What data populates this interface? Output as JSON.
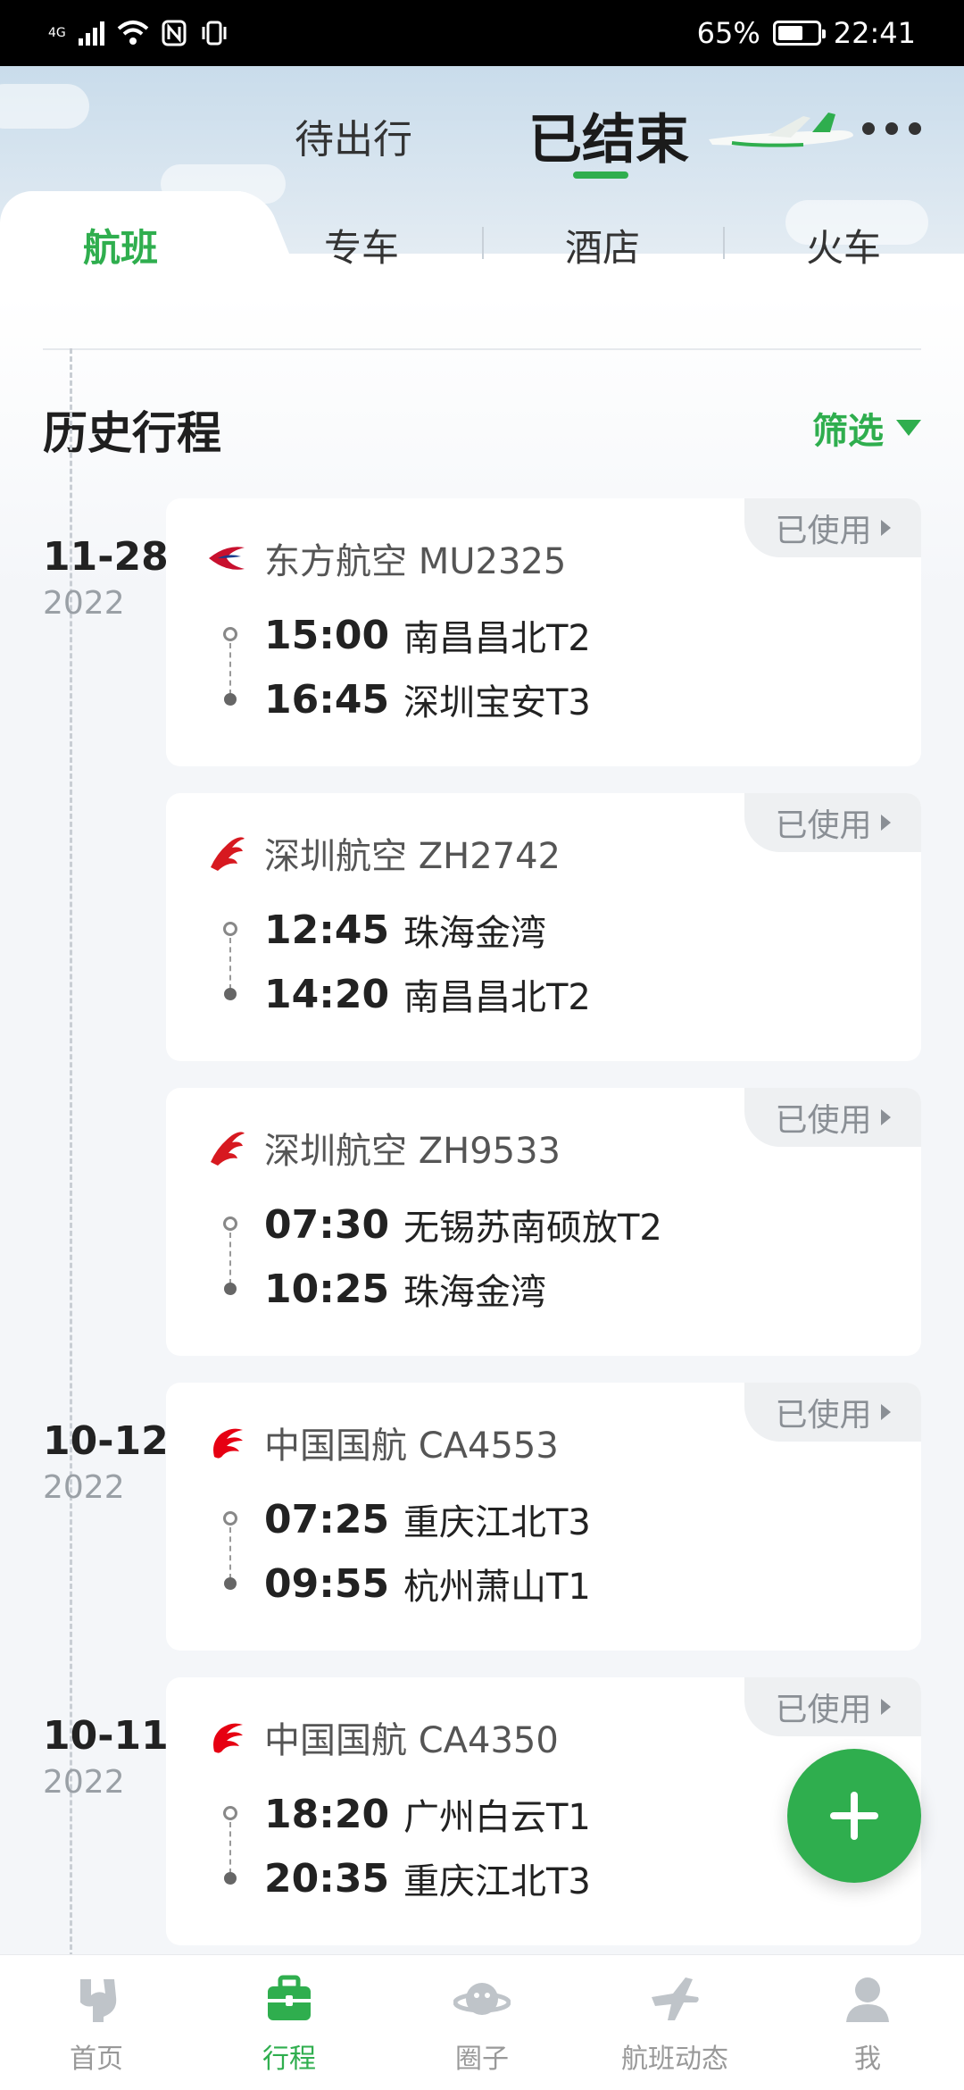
{
  "status_bar": {
    "network": "4G",
    "battery": "65%",
    "battery_level": 0.65,
    "time": "22:41"
  },
  "header": {
    "tab_pending": "待出行",
    "tab_ended": "已结束"
  },
  "categories": [
    {
      "label": "航班",
      "active": true
    },
    {
      "label": "专车",
      "active": false
    },
    {
      "label": "酒店",
      "active": false
    },
    {
      "label": "火车",
      "active": false
    }
  ],
  "section": {
    "title": "历史行程",
    "filter_label": "筛选"
  },
  "dates": [
    {
      "day": "11-28",
      "year": "2022"
    },
    {
      "day": "10-12",
      "year": "2022"
    },
    {
      "day": "10-11",
      "year": "2022"
    }
  ],
  "trips": [
    {
      "airline": "东方航空 MU2325",
      "logo": "china-eastern-logo",
      "status": "已使用",
      "dep_time": "15:00",
      "dep_airport": "南昌昌北T2",
      "arr_time": "16:45",
      "arr_airport": "深圳宝安T3"
    },
    {
      "airline": "深圳航空 ZH2742",
      "logo": "shenzhen-airlines-logo",
      "status": "已使用",
      "dep_time": "12:45",
      "dep_airport": "珠海金湾",
      "arr_time": "14:20",
      "arr_airport": "南昌昌北T2"
    },
    {
      "airline": "深圳航空 ZH9533",
      "logo": "shenzhen-airlines-logo",
      "status": "已使用",
      "dep_time": "07:30",
      "dep_airport": "无锡苏南硕放T2",
      "arr_time": "10:25",
      "arr_airport": "珠海金湾"
    },
    {
      "airline": "中国国航 CA4553",
      "logo": "air-china-logo",
      "status": "已使用",
      "dep_time": "07:25",
      "dep_airport": "重庆江北T3",
      "arr_time": "09:55",
      "arr_airport": "杭州萧山T1"
    },
    {
      "airline": "中国国航 CA4350",
      "logo": "air-china-logo",
      "status": "已使用",
      "dep_time": "18:20",
      "dep_airport": "广州白云T1",
      "arr_time": "20:35",
      "arr_airport": "重庆江北T3"
    }
  ],
  "bottom_nav": [
    {
      "label": "首页",
      "icon": "home-icon",
      "active": false
    },
    {
      "label": "行程",
      "icon": "suitcase-icon",
      "active": true
    },
    {
      "label": "圈子",
      "icon": "planet-icon",
      "active": false
    },
    {
      "label": "航班动态",
      "icon": "plane-icon",
      "active": false
    },
    {
      "label": "我",
      "icon": "profile-icon",
      "active": false
    }
  ],
  "colors": {
    "accent": "#2fae4e",
    "eastern_red": "#c8102e",
    "shenzhen_red": "#d71920",
    "airchina_red": "#e60012"
  }
}
